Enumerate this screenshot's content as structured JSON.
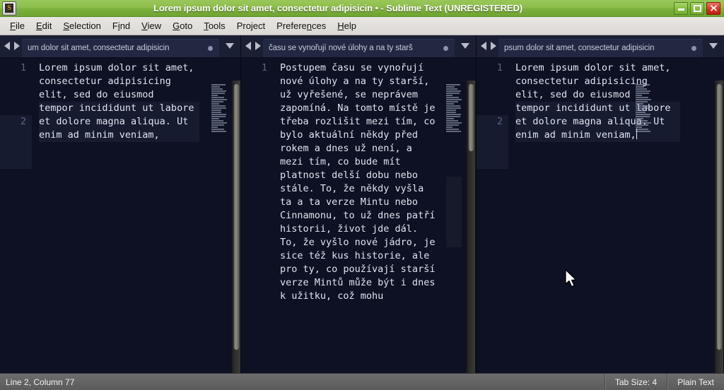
{
  "window": {
    "title": "Lorem ipsum dolor sit amet, consectetur adipisicin • - Sublime Text (UNREGISTERED)",
    "app_icon_glyph": "S",
    "minimize_label": "Minimize",
    "maximize_label": "Maximize",
    "close_label": "Close"
  },
  "menubar": {
    "items": [
      {
        "label": "File",
        "mnemonic": "F"
      },
      {
        "label": "Edit",
        "mnemonic": "E"
      },
      {
        "label": "Selection",
        "mnemonic": "S"
      },
      {
        "label": "Find",
        "mnemonic": "i"
      },
      {
        "label": "View",
        "mnemonic": "V"
      },
      {
        "label": "Goto",
        "mnemonic": "G"
      },
      {
        "label": "Tools",
        "mnemonic": "T"
      },
      {
        "label": "Project",
        "mnemonic": ""
      },
      {
        "label": "Preferences",
        "mnemonic": "n"
      },
      {
        "label": "Help",
        "mnemonic": "H"
      }
    ]
  },
  "panes": [
    {
      "tab": {
        "label": "um dolor sit amet, consectetur adipisicin",
        "dirty": true
      },
      "lines": [
        {
          "number": "1",
          "text": "Lorem ipsum dolor sit amet, consectetur adipisicing elit, sed do eiusmod",
          "active": false
        },
        {
          "number": "2",
          "text": "tempor incididunt ut labore et dolore magna aliqua. Ut enim ad minim veniam,",
          "active": true
        }
      ],
      "cursor_visible": false
    },
    {
      "tab": {
        "label": "času se vynořují nové úlohy a na ty starš",
        "dirty": true
      },
      "lines": [
        {
          "number": "1",
          "text": "Postupem času se vynořují nové úlohy a na ty starší, už vyřešené, se neprávem zapomíná. Na tomto místě je třeba rozlišit mezi tím, co bylo aktuální někdy před rokem a dnes už není, a mezi tím, co bude mít platnost delší dobu nebo stále. To, že někdy vyšla ta a ta verze Mintu nebo Cinnamonu, to už dnes patří historii, život jde dál. To, že vyšlo nové jádro, je sice též kus historie, ale pro ty, co používají starší verze Mintů může být i dnes k užitku, což mohu",
          "active": false
        }
      ],
      "cursor_visible": false
    },
    {
      "tab": {
        "label": "psum dolor sit amet, consectetur adipisicin",
        "dirty": true
      },
      "lines": [
        {
          "number": "1",
          "text": "Lorem ipsum dolor sit amet, consectetur adipisicing elit, sed do eiusmod",
          "active": false
        },
        {
          "number": "2",
          "text": "tempor incididunt ut labore et dolore magna aliqua. Ut enim ad minim veniam,",
          "active": true
        }
      ],
      "cursor_visible": true
    }
  ],
  "statusbar": {
    "position": "Line 2, Column 77",
    "tab_size": "Tab Size: 4",
    "syntax": "Plain Text"
  },
  "colors": {
    "titlebar_green": "#8dbd4c",
    "close_red": "#d83b2c",
    "editor_bg": "#0d1123",
    "editor_text": "#dfe3ef",
    "gutter_text": "#5d6480",
    "active_line_bg": "#161b30",
    "statusbar_bg": "#5b5b5b"
  }
}
